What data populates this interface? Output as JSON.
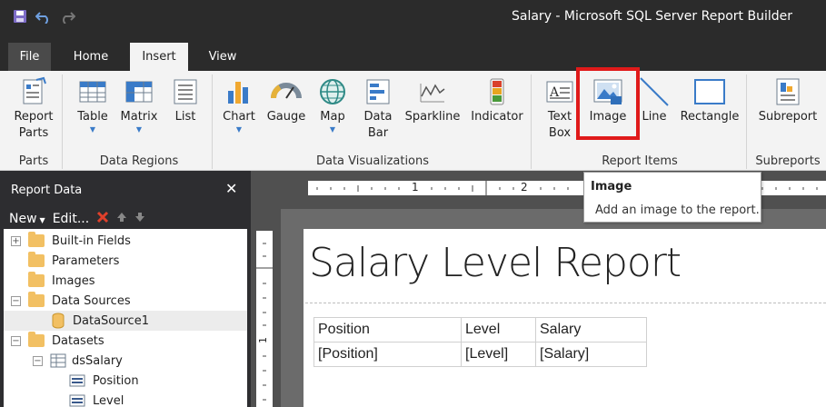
{
  "window": {
    "title": "Salary - Microsoft SQL Server Report Builder"
  },
  "tabs": [
    {
      "label": "File"
    },
    {
      "label": "Home"
    },
    {
      "label": "Insert"
    },
    {
      "label": "View"
    }
  ],
  "ribbon": {
    "groups": {
      "parts": "Parts",
      "data_regions": "Data Regions",
      "data_visualizations": "Data Visualizations",
      "report_items": "Report Items",
      "subreports": "Subreports"
    },
    "buttons": {
      "report_parts": [
        "Report",
        "Parts"
      ],
      "table": "Table",
      "matrix": "Matrix",
      "list": "List",
      "chart": "Chart",
      "gauge": "Gauge",
      "map": "Map",
      "data_bar": [
        "Data",
        "Bar"
      ],
      "sparkline": "Sparkline",
      "indicator": "Indicator",
      "text_box": [
        "Text",
        "Box"
      ],
      "image": "Image",
      "line": "Line",
      "rectangle": "Rectangle",
      "subreport": "Subreport"
    }
  },
  "tooltip": {
    "title": "Image",
    "description": "Add an image to the report."
  },
  "report_data": {
    "title": "Report Data",
    "close": "✕",
    "new_label": "New",
    "edit_label": "Edit...",
    "tree": [
      {
        "label": "Built-in Fields"
      },
      {
        "label": "Parameters"
      },
      {
        "label": "Images"
      },
      {
        "label": "Data Sources"
      },
      {
        "label": "DataSource1"
      },
      {
        "label": "Datasets"
      },
      {
        "label": "dsSalary"
      },
      {
        "label": "Position"
      },
      {
        "label": "Level"
      }
    ]
  },
  "ruler": {
    "mark1": "1",
    "mark2": "2",
    "vmark1": "1"
  },
  "report": {
    "title": "Salary Level Report",
    "headers": [
      "Position",
      "Level",
      "Salary"
    ],
    "fields": [
      "[Position]",
      "[Level]",
      "[Salary]"
    ]
  },
  "colors": {
    "accent": "#3a7bc8",
    "highlight": "#e01a1a",
    "folder": "#f2c063"
  }
}
